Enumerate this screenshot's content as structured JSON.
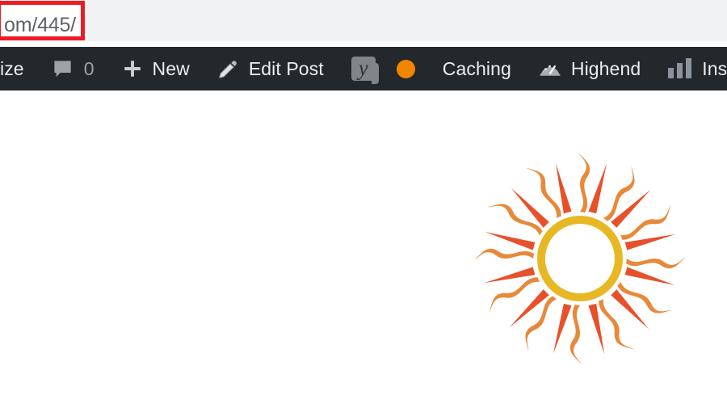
{
  "browser": {
    "url_fragment": "om/445/",
    "highlight_color": "#ed1c24",
    "field_background": "#f1f2f4"
  },
  "admin_bar": {
    "background_color": "#23282d",
    "text_color": "#eeeeee",
    "icon_color": "#a0a5aa",
    "items": [
      {
        "id": "customize",
        "label": "ize",
        "icon": "none",
        "truncated": true
      },
      {
        "id": "comments",
        "label": "",
        "icon": "comment-bubble-icon",
        "count": "0"
      },
      {
        "id": "new",
        "label": "New",
        "icon": "plus-icon"
      },
      {
        "id": "edit-post",
        "label": "Edit Post",
        "icon": "pencil-icon"
      },
      {
        "id": "yoast-seo",
        "label": "",
        "icon": "yoast-logo-icon"
      },
      {
        "id": "seo-status",
        "label": "",
        "icon": "status-dot-icon",
        "color": "#f18500"
      },
      {
        "id": "caching",
        "label": "Caching",
        "icon": "none"
      },
      {
        "id": "highend",
        "label": "Highend",
        "icon": "speedometer-icon"
      },
      {
        "id": "insights",
        "label": "Insights",
        "icon": "bar-chart-icon"
      }
    ]
  },
  "page": {
    "background_color": "#ffffff",
    "logo": {
      "name": "sun-logo",
      "ring_color": "#e8b724",
      "wavy_ray_color": "#e8893a",
      "straight_ray_color": "#e8502a",
      "ray_pairs": 12
    }
  }
}
